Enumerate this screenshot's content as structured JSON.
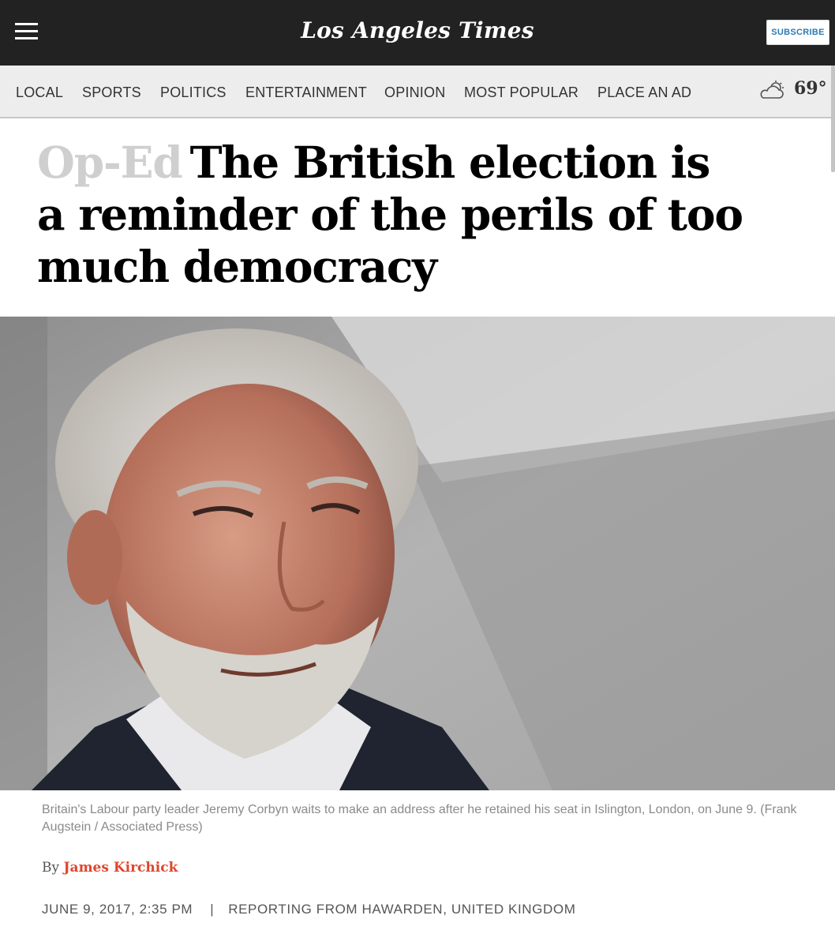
{
  "header": {
    "logo_text": "Los Angeles Times",
    "subscribe_label": "SUBSCRIBE"
  },
  "nav": {
    "items": [
      {
        "label": "LOCAL"
      },
      {
        "label": "SPORTS"
      },
      {
        "label": "POLITICS"
      },
      {
        "label": "ENTERTAINMENT"
      },
      {
        "label": "OPINION"
      },
      {
        "label": "MOST POPULAR"
      },
      {
        "label": "PLACE AN AD"
      }
    ],
    "weather": {
      "icon": "partly-cloudy-icon",
      "temperature": "69°"
    }
  },
  "article": {
    "kicker": "Op-Ed",
    "title": "The British election is a reminder of the perils of too much democracy",
    "photo_caption": "Britain's Labour party leader Jeremy Corbyn waits to make an address after he retained his seat in Islington, London, on June 9. (Frank Augstein / Associated Press)",
    "byline_prefix": "By",
    "author": "James Kirchick",
    "date": "JUNE 9, 2017, 2:35 PM",
    "separator": "|",
    "dateline": "REPORTING FROM HAWARDEN, UNITED KINGDOM"
  },
  "colors": {
    "header_bg": "#222222",
    "nav_bg": "#ededed",
    "kicker": "#cfcfcf",
    "author_link": "#e0452d",
    "subscribe_text": "#2b7bb5"
  }
}
